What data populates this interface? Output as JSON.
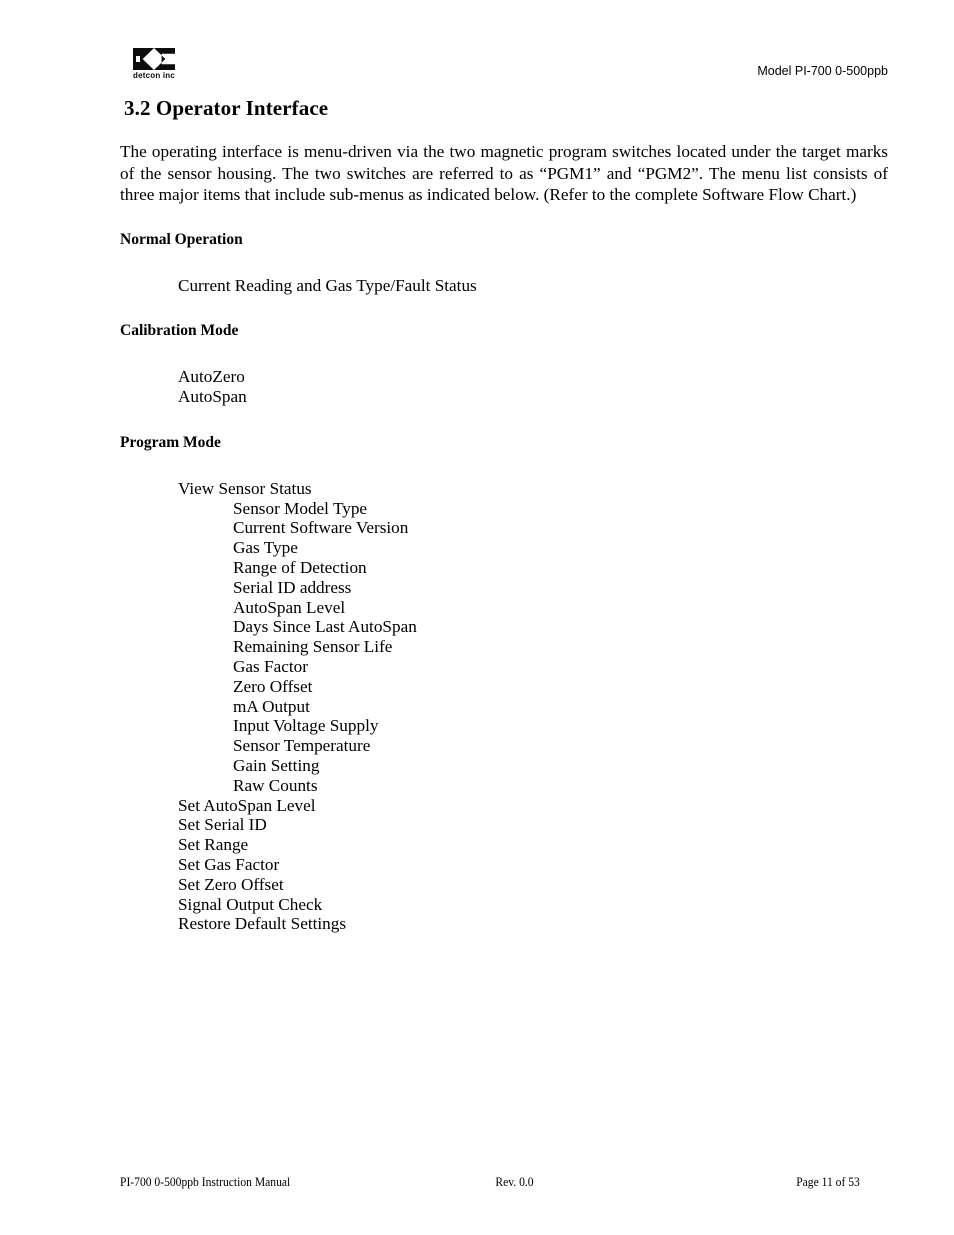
{
  "header": {
    "logo_wordmark": "detcon inc",
    "logo_icon": "detcon-dc-monogram",
    "model_text": "Model PI-700 0-500ppb"
  },
  "document": {
    "section_number_title": "3.2 Operator Interface",
    "intro_paragraph": "The operating interface is menu-driven via the two magnetic program switches located under the target marks of the sensor housing.  The two switches are referred to as “PGM1” and “PGM2”.  The menu list consists of three major items that include sub-menus as indicated below.  (Refer to the complete Software Flow Chart.)",
    "groups": [
      {
        "heading": "Normal Operation",
        "items": [
          {
            "label": "Current Reading and Gas Type/Fault Status",
            "level": 1
          }
        ]
      },
      {
        "heading": "Calibration Mode",
        "items": [
          {
            "label": "AutoZero",
            "level": 1
          },
          {
            "label": "AutoSpan",
            "level": 1
          }
        ]
      },
      {
        "heading": "Program Mode",
        "items": [
          {
            "label": "View Sensor Status",
            "level": 1
          },
          {
            "label": "Sensor Model Type",
            "level": 2
          },
          {
            "label": "Current Software Version",
            "level": 2
          },
          {
            "label": "Gas Type",
            "level": 2
          },
          {
            "label": "Range of Detection",
            "level": 2
          },
          {
            "label": "Serial ID address",
            "level": 2
          },
          {
            "label": "AutoSpan Level",
            "level": 2
          },
          {
            "label": "Days Since Last AutoSpan",
            "level": 2
          },
          {
            "label": "Remaining Sensor Life",
            "level": 2
          },
          {
            "label": "Gas Factor",
            "level": 2
          },
          {
            "label": "Zero Offset",
            "level": 2
          },
          {
            "label": "mA Output",
            "level": 2
          },
          {
            "label": "Input Voltage Supply",
            "level": 2
          },
          {
            "label": "Sensor Temperature",
            "level": 2
          },
          {
            "label": "Gain Setting",
            "level": 2
          },
          {
            "label": "Raw Counts",
            "level": 2
          },
          {
            "label": "Set AutoSpan Level",
            "level": 1
          },
          {
            "label": "Set Serial ID",
            "level": 1
          },
          {
            "label": "Set Range",
            "level": 1
          },
          {
            "label": "Set Gas Factor",
            "level": 1
          },
          {
            "label": "Set Zero Offset",
            "level": 1
          },
          {
            "label": "Signal Output Check",
            "level": 1
          },
          {
            "label": "Restore Default Settings",
            "level": 1
          }
        ]
      }
    ]
  },
  "footer": {
    "left": "PI-700 0-500ppb Instruction Manual",
    "center": "Rev. 0.0",
    "right": "Page 11 of 53"
  },
  "colors": {
    "page_background": "#ffffff",
    "text": "#000000",
    "logo": "#0d0d0d"
  }
}
